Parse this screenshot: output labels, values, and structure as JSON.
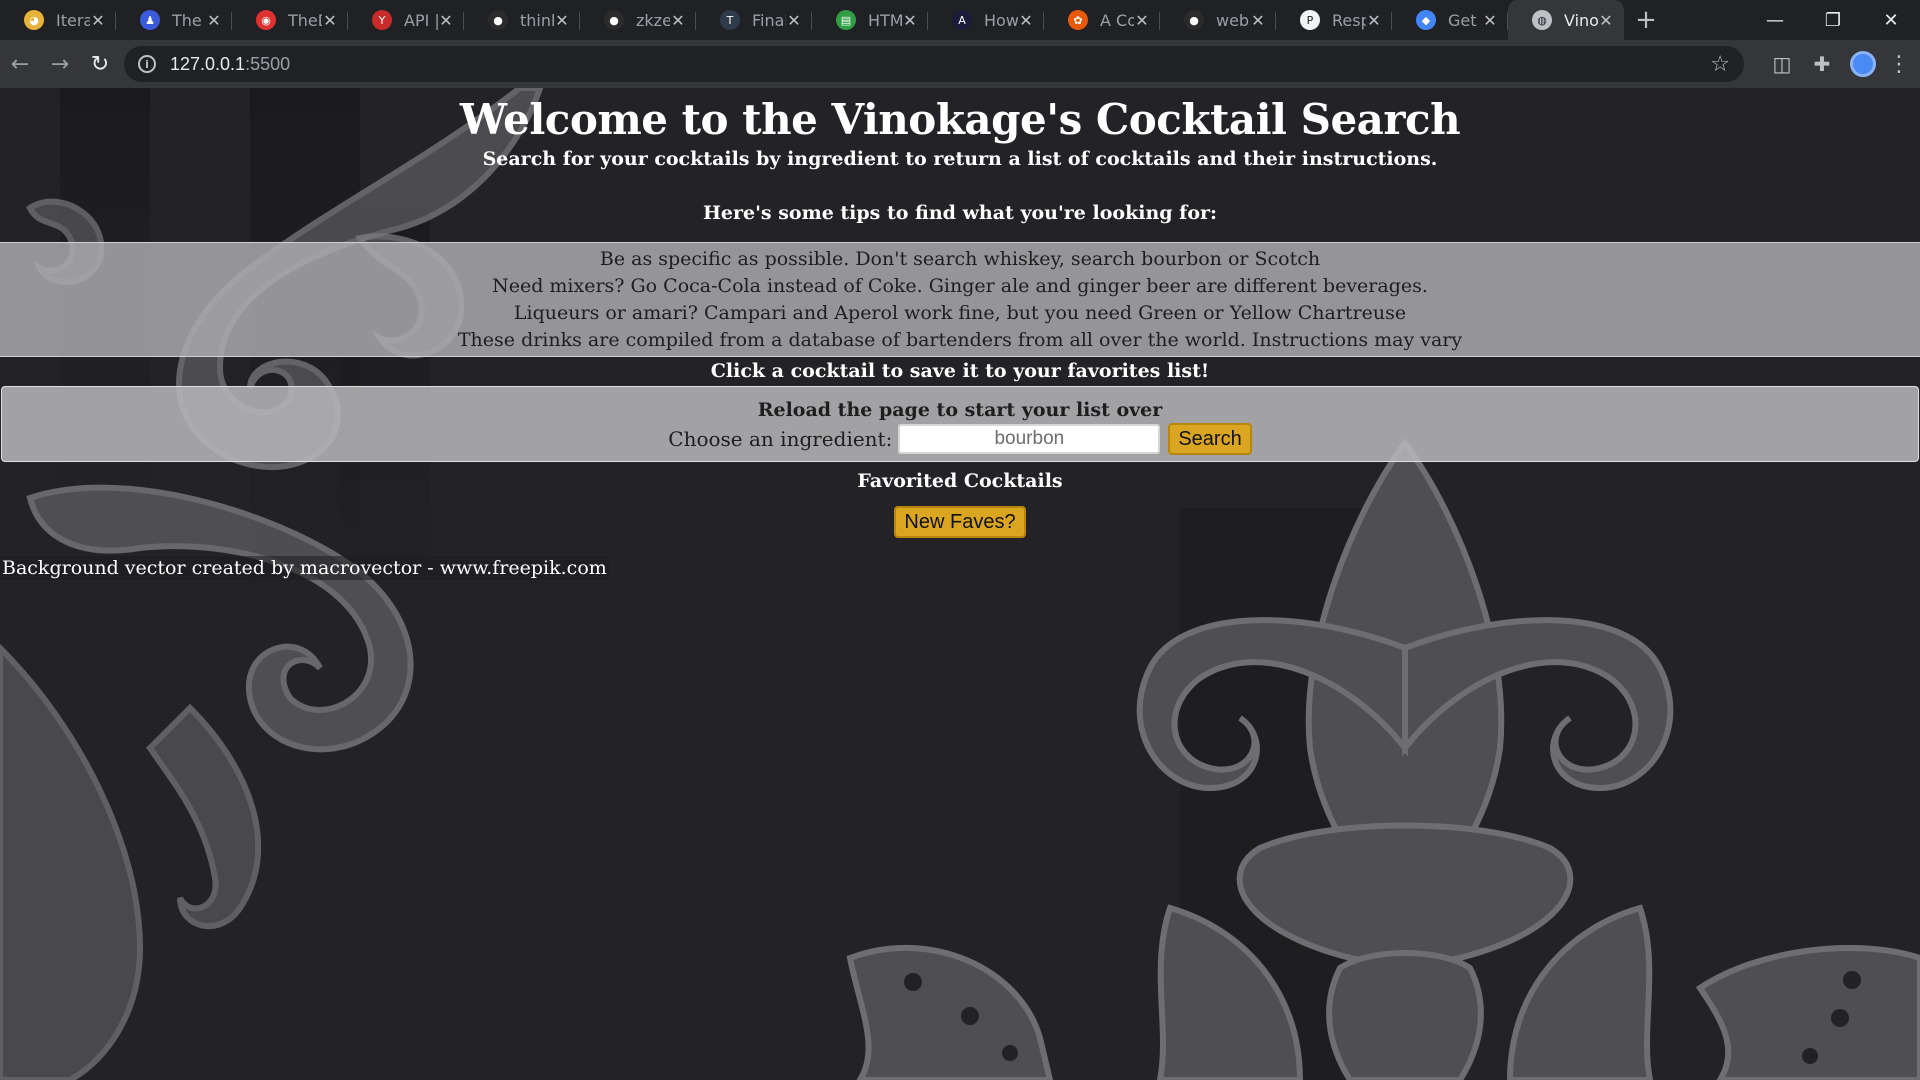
{
  "browser": {
    "tabs": [
      {
        "title": "Iterati",
        "favicon_color": "#e8b339",
        "favicon_glyph": "◕"
      },
      {
        "title": "The C",
        "favicon_color": "#3b5bdb",
        "favicon_glyph": "♟"
      },
      {
        "title": "TheD",
        "favicon_color": "#e03131",
        "favicon_glyph": "◉"
      },
      {
        "title": "API |",
        "favicon_color": "#c92a2a",
        "favicon_glyph": "Y"
      },
      {
        "title": "think",
        "favicon_color": "#2b2b2b",
        "favicon_glyph": "●"
      },
      {
        "title": "zkzer",
        "favicon_color": "#2b2b2b",
        "favicon_glyph": "●"
      },
      {
        "title": "Finali",
        "favicon_color": "#2f3a4a",
        "favicon_glyph": "T"
      },
      {
        "title": "HTML",
        "favicon_color": "#2f9e44",
        "favicon_glyph": "▤"
      },
      {
        "title": "How",
        "favicon_color": "#1c1c3a",
        "favicon_glyph": "A"
      },
      {
        "title": "A Cor",
        "favicon_color": "#e8590c",
        "favicon_glyph": "✿"
      },
      {
        "title": "web-",
        "favicon_color": "#2b2b2b",
        "favicon_glyph": "●"
      },
      {
        "title": "Respo",
        "favicon_color": "#f1f3f4",
        "favicon_glyph": "P"
      },
      {
        "title": "Get S",
        "favicon_color": "#4285f4",
        "favicon_glyph": "◆"
      },
      {
        "title": "Vinok",
        "favicon_color": "#bdc1c6",
        "favicon_glyph": "◍"
      }
    ],
    "active_tab_index": 13,
    "url_host": "127.0.0.1",
    "url_port": ":5500",
    "icons": {
      "back": "back-arrow-icon",
      "forward": "forward-arrow-icon",
      "reload": "reload-icon",
      "bookmark": "star-icon",
      "extensions": "puzzle-icon",
      "menu": "kebab-menu-icon"
    }
  },
  "page": {
    "title": "Welcome to the Vinokage's Cocktail Search",
    "subtitle": "Search for your cocktails by ingredient to return a list of cocktails and their instructions.",
    "tips_heading": "Here's some tips to find what you're looking for:",
    "tips": [
      "Be as specific as possible. Don't search whiskey, search bourbon or Scotch",
      "Need mixers? Go Coca-Cola instead of Coke. Ginger ale and ginger beer are different beverages.",
      "Liqueurs or amari? Campari and Aperol work fine, but you need Green or Yellow Chartreuse",
      "These drinks are compiled from a database of bartenders from all over the world. Instructions may vary"
    ],
    "click_note": "Click a cocktail to save it to your favorites list!",
    "reload_note": "Reload the page to start your list over",
    "ingredient_label": "Choose an ingredient:",
    "ingredient_value": "bourbon",
    "search_label": "Search",
    "favorites_heading": "Favorited Cocktails",
    "new_faves_label": "New Faves?",
    "credit": "Background vector created by macrovector - www.freepik.com"
  },
  "colors": {
    "button_gold": "#daa520",
    "page_bg": "#232327",
    "ornament": "#5c5c60"
  }
}
